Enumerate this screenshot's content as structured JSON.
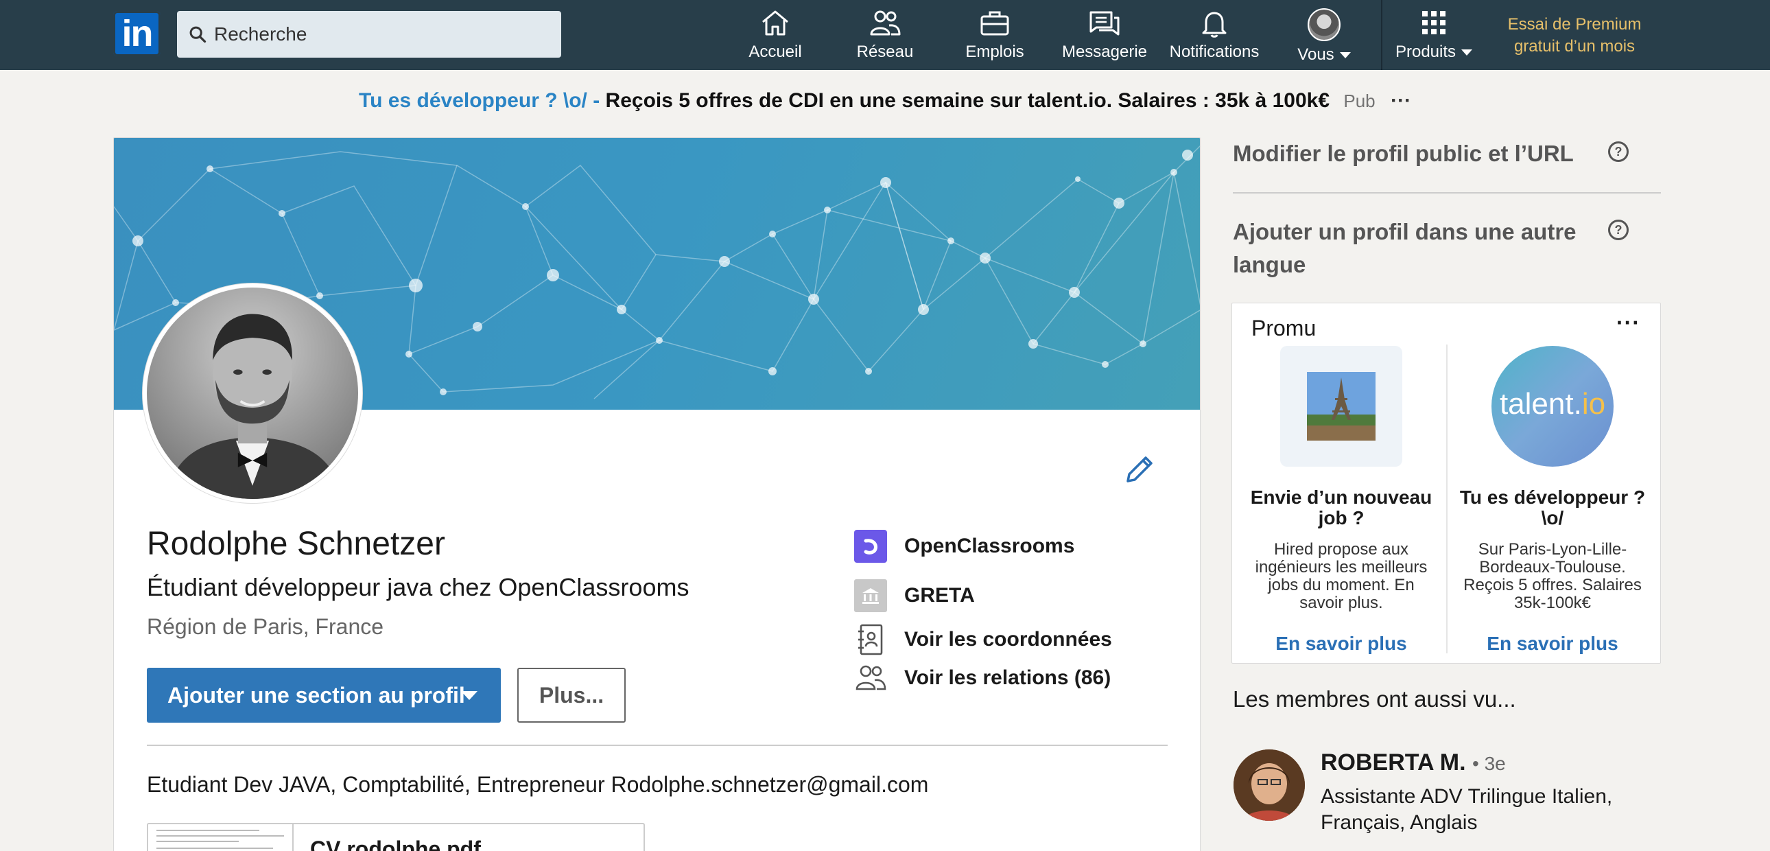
{
  "nav": {
    "logo_text": "in",
    "search_placeholder": "Recherche",
    "items": [
      {
        "label": "Accueil",
        "icon": "home-icon"
      },
      {
        "label": "Réseau",
        "icon": "network-icon"
      },
      {
        "label": "Emplois",
        "icon": "briefcase-icon"
      },
      {
        "label": "Messagerie",
        "icon": "messaging-icon"
      },
      {
        "label": "Notifications",
        "icon": "bell-icon"
      },
      {
        "label": "Vous",
        "icon": "avatar"
      },
      {
        "label": "Produits",
        "icon": "grid-icon"
      }
    ],
    "premium_line1": "Essai de Premium",
    "premium_line2": "gratuit d’un mois",
    "colors": {
      "bar": "#283e4a",
      "premium": "#e7c06a"
    }
  },
  "ad": {
    "highlight": "Tu es développeur ? \\o/ -",
    "text": "Reçois 5 offres de CDI en une semaine sur talent.io. Salaires : 35k à 100k€",
    "pub": "Pub",
    "more": "···"
  },
  "profile": {
    "name": "Rodolphe Schnetzer",
    "headline": "Étudiant développeur java chez OpenClassrooms",
    "location": "Région de Paris, France",
    "add_section_label": "Ajouter une section au profil",
    "more_label": "Plus...",
    "company": "OpenClassrooms",
    "school": "GRETA",
    "contact_link": "Voir les coordonnées",
    "connections_link": "Voir les relations (86)",
    "summary": "Etudiant Dev JAVA, Comptabilité, Entrepreneur Rodolphe.schnetzer@gmail.com",
    "document_name": "CV rodolphe.pdf",
    "colors": {
      "primary_button": "#2f77b8"
    }
  },
  "sidebar": {
    "edit_public_profile": "Modifier le profil public et l’URL",
    "add_language_profile": "Ajouter un profil dans une autre langue",
    "help_glyph": "?",
    "promo": {
      "title": "Promu",
      "more": "···",
      "items": [
        {
          "heading": "Envie d’un nouveau job ?",
          "description": "Hired propose aux ingénieurs les meilleurs jobs du moment. En savoir plus.",
          "link": "En savoir plus",
          "image": "eiffel-tower-image"
        },
        {
          "heading": "Tu es développeur ? \\o/",
          "description": "Sur Paris-Lyon-Lille-Bordeaux-Toulouse. Reçois 5 offres. Salaires 35k-100k€",
          "link": "En savoir plus",
          "image": "talent-io-logo",
          "logo_text_1": "talent.",
          "logo_text_2": "io"
        }
      ]
    },
    "also_viewed_title": "Les membres ont aussi vu...",
    "members": [
      {
        "name": "ROBERTA M.",
        "degree": "• 3e",
        "description": "Assistante ADV Trilingue Italien, Français, Anglais"
      }
    ]
  }
}
